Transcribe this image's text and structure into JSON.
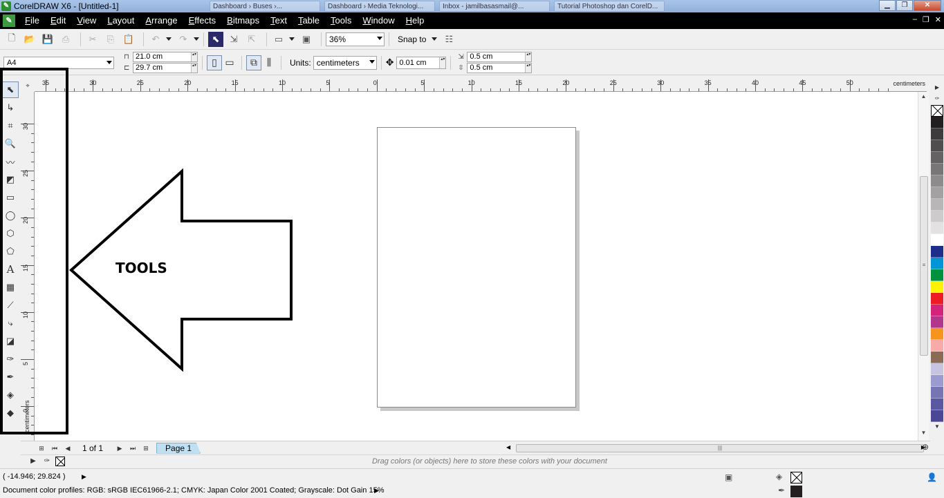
{
  "window": {
    "title": "CorelDRAW X6 - [Untitled-1]",
    "taskbar_tabs": [
      "Dashboard › Buses ›...",
      "Dashboard › Media Teknologi...",
      "Inbox - jamilbasasmail@...",
      "Tutorial Photoshop dan CorelD..."
    ]
  },
  "menu": {
    "items": [
      "File",
      "Edit",
      "View",
      "Layout",
      "Arrange",
      "Effects",
      "Bitmaps",
      "Text",
      "Table",
      "Tools",
      "Window",
      "Help"
    ]
  },
  "toolbar": {
    "zoom_level": "36%",
    "snap_label": "Snap to"
  },
  "property_bar": {
    "page_size": "A4",
    "width": "21.0 cm",
    "height": "29.7 cm",
    "units_label": "Units:",
    "units_value": "centimeters",
    "nudge": "0.01 cm",
    "dup_x": "0.5 cm",
    "dup_y": "0.5 cm"
  },
  "rulers": {
    "unit": "centimeters",
    "h_labels": [
      "35",
      "30",
      "25",
      "20",
      "15",
      "10",
      "5",
      "0",
      "5",
      "10",
      "15",
      "20",
      "25",
      "30",
      "35",
      "40",
      "45",
      "50"
    ],
    "v_labels": [
      "30",
      "25",
      "20",
      "15",
      "10",
      "5",
      "0"
    ]
  },
  "annotation": {
    "label": "TOOLS"
  },
  "palette": {
    "colors": [
      "#231f20",
      "#3d3b3c",
      "#4f4d4e",
      "#646263",
      "#787677",
      "#8d8b8c",
      "#a3a1a2",
      "#b8b6b7",
      "#cdcbcc",
      "#e3e1e2",
      "#ffffff",
      "#1d2d8c",
      "#0096d6",
      "#00923f",
      "#fff200",
      "#ed1c24",
      "#d4237a",
      "#b1368c",
      "#f7941d",
      "#f7aaa8",
      "#8a6b55",
      "#c6c4e0",
      "#9c9bd0",
      "#7774b4",
      "#5b58a2",
      "#4a4796"
    ]
  },
  "page_nav": {
    "count": "1 of 1",
    "tab_label": "Page 1"
  },
  "doc_palette": {
    "hint": "Drag colors (or objects) here to store these colors with your document"
  },
  "status": {
    "coords": "( -14.946; 29.824 )",
    "profiles": "Document color profiles: RGB: sRGB IEC61966-2.1; CMYK: Japan Color 2001 Coated; Grayscale: Dot Gain 15%"
  }
}
